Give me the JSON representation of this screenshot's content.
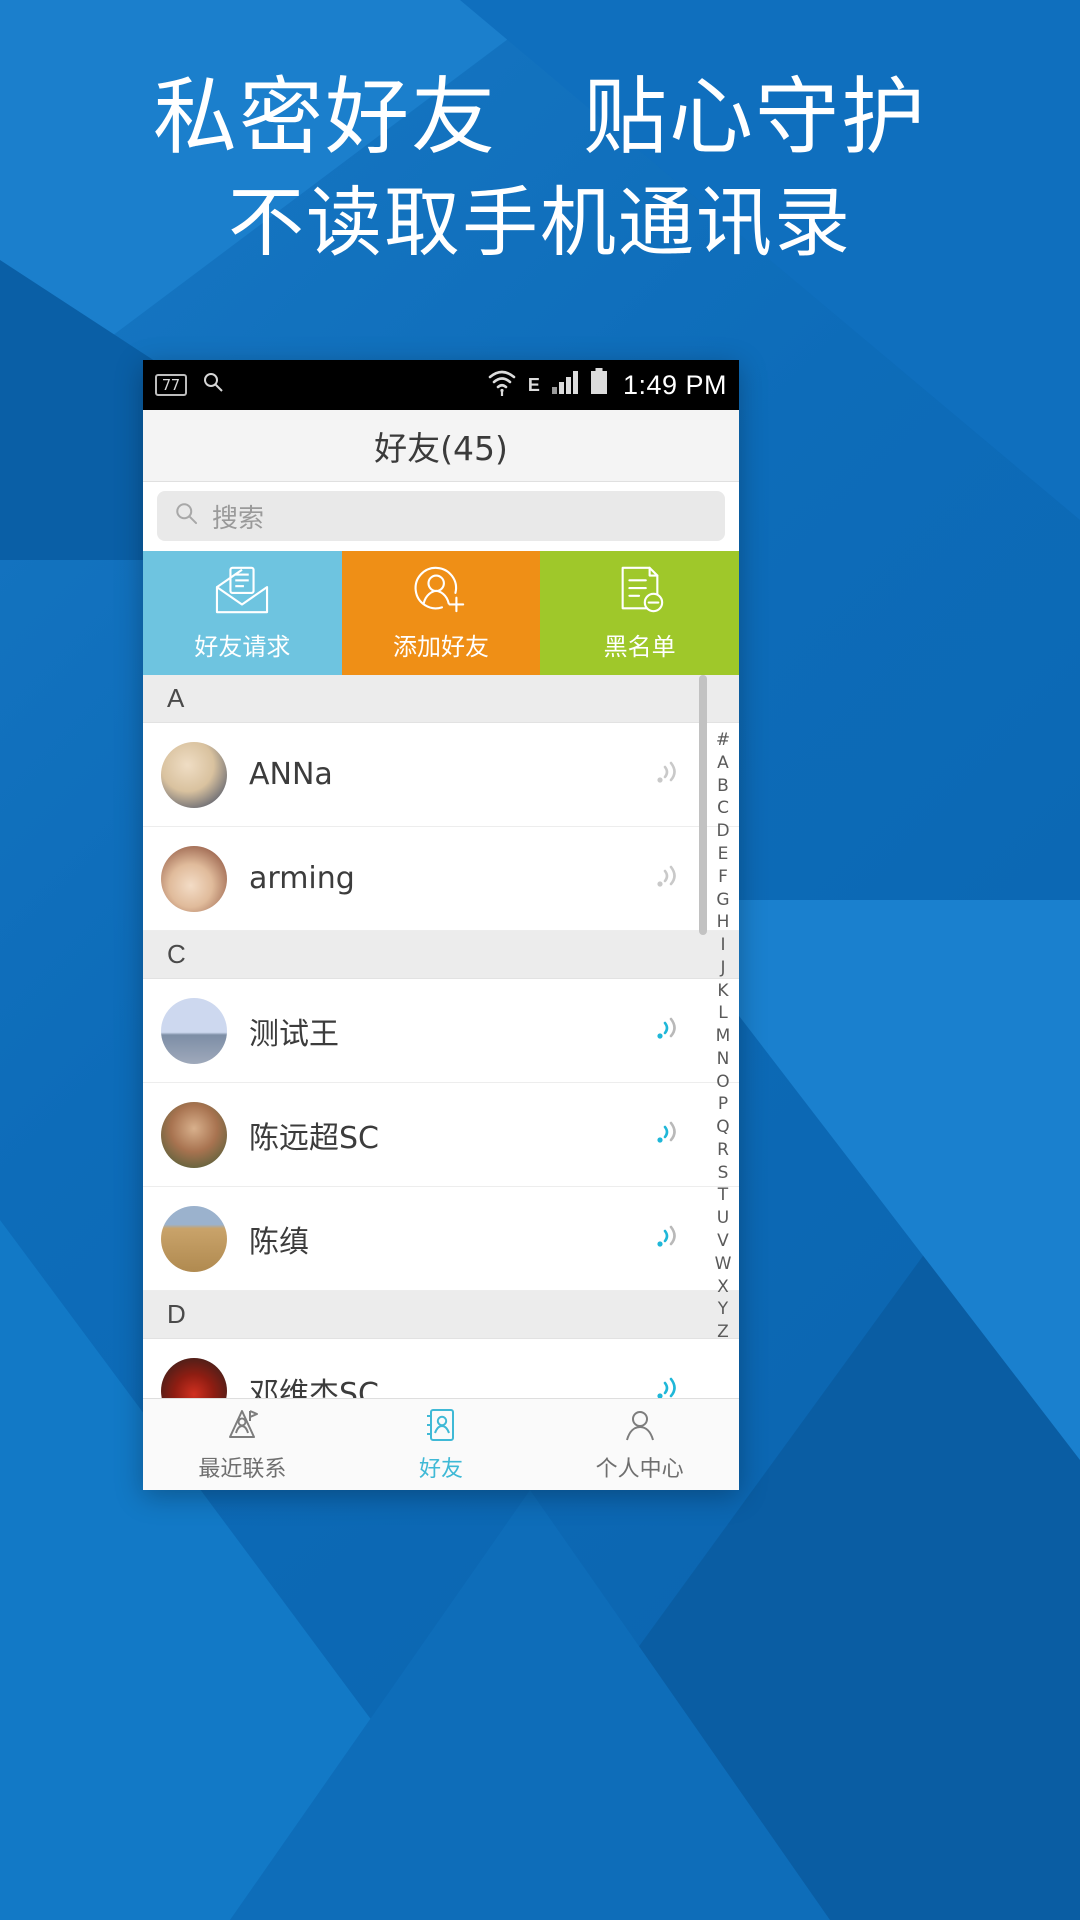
{
  "poster": {
    "headline_line1": "私密好友　贴心守护",
    "headline_line2": "不读取手机通讯录",
    "bg_color": "#0d6cb9"
  },
  "statusbar": {
    "badge": "77",
    "search_icon": "search-icon",
    "wifi_icon": "wifi-icon",
    "network_label": "E",
    "signal_icon": "signal-bars-icon",
    "battery_icon": "battery-icon",
    "time": "1:49 PM"
  },
  "titlebar": {
    "title": "好友(45)"
  },
  "search": {
    "placeholder": "搜索",
    "value": ""
  },
  "action_tabs": [
    {
      "label": "好友请求",
      "icon": "envelope-open-icon",
      "color": "#6ec4e0"
    },
    {
      "label": "添加好友",
      "icon": "person-add-icon",
      "color": "#ef8f16"
    },
    {
      "label": "黑名单",
      "icon": "document-block-icon",
      "color": "#9fc82a"
    }
  ],
  "contacts": {
    "sections": [
      {
        "letter": "A",
        "rows": [
          {
            "name": "ANNa",
            "avatar": "avatar-anna",
            "wave": "signal-wave-icon",
            "wave_active": false
          },
          {
            "name": "arming",
            "avatar": "avatar-arming",
            "wave": "signal-wave-icon",
            "wave_active": false
          }
        ]
      },
      {
        "letter": "C",
        "rows": [
          {
            "name": "测试王",
            "avatar": "avatar-ceshiwang",
            "wave": "signal-wave-icon",
            "wave_active": true
          },
          {
            "name": "陈远超SC",
            "avatar": "avatar-chenyuanchao",
            "wave": "signal-wave-icon",
            "wave_active": true
          },
          {
            "name": "陈缜",
            "avatar": "avatar-chenzhen",
            "wave": "signal-wave-icon",
            "wave_active": true
          }
        ]
      },
      {
        "letter": "D",
        "rows": [
          {
            "name": "邓维杰SC",
            "avatar": "avatar-dengweijie",
            "wave": "signal-wave-icon",
            "wave_active": true
          }
        ]
      }
    ],
    "alpha_index": [
      "#",
      "A",
      "B",
      "C",
      "D",
      "E",
      "F",
      "G",
      "H",
      "I",
      "J",
      "K",
      "L",
      "M",
      "N",
      "O",
      "P",
      "Q",
      "R",
      "S",
      "T",
      "U",
      "V",
      "W",
      "X",
      "Y",
      "Z"
    ]
  },
  "bottom_nav": [
    {
      "label": "最近联系",
      "icon": "recent-contacts-icon",
      "active": false
    },
    {
      "label": "好友",
      "icon": "friends-icon",
      "active": true
    },
    {
      "label": "个人中心",
      "icon": "profile-icon",
      "active": false
    }
  ],
  "colors": {
    "accent_cyan": "#3fb9d6",
    "tab_blue": "#6ec4e0",
    "tab_orange": "#ef8f16",
    "tab_green": "#9fc82a",
    "poster_blue": "#0d6cb9"
  }
}
